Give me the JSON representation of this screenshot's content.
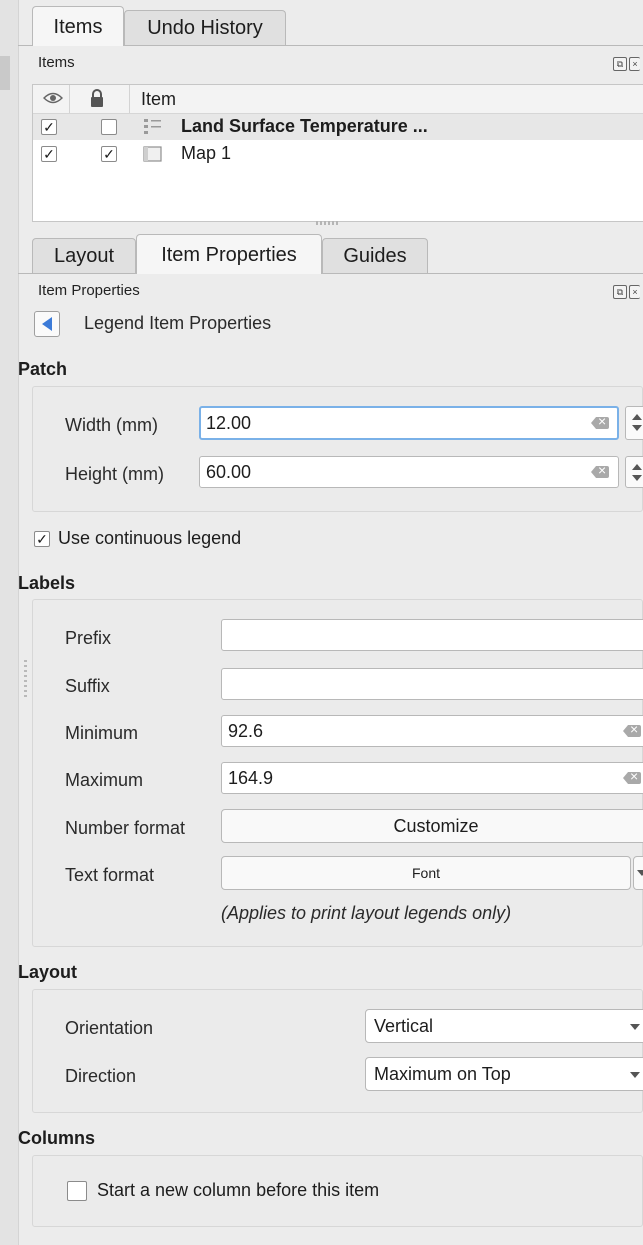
{
  "top_tabs": [
    "Items",
    "Undo History"
  ],
  "items_dock": {
    "title": "Items",
    "column_item": "Item",
    "rows": [
      {
        "name": "Land Surface Temperature ...",
        "visible": "✓",
        "locked": "",
        "bold": true
      },
      {
        "name": "Map 1",
        "visible": "✓",
        "locked": "✓",
        "bold": false
      }
    ]
  },
  "lower_tabs": [
    "Layout",
    "Item Properties",
    "Guides"
  ],
  "props_dock": {
    "title": "Item Properties",
    "header": "Legend Item Properties"
  },
  "patch": {
    "title": "Patch",
    "width_label": "Width (mm)",
    "width_value": "12.00",
    "height_label": "Height (mm)",
    "height_value": "60.00"
  },
  "continuous": {
    "checkmark": "✓",
    "label": "Use continuous legend"
  },
  "labels": {
    "title": "Labels",
    "prefix_label": "Prefix",
    "prefix_value": "",
    "suffix_label": "Suffix",
    "suffix_value": "",
    "minimum_label": "Minimum",
    "minimum_value": "92.6",
    "maximum_label": "Maximum",
    "maximum_value": "164.9",
    "number_format_label": "Number format",
    "customize_button": "Customize",
    "text_format_label": "Text format",
    "font_button": "Font",
    "note": "(Applies to print layout legends only)"
  },
  "layout_section": {
    "title": "Layout",
    "orientation_label": "Orientation",
    "orientation_value": "Vertical",
    "direction_label": "Direction",
    "direction_value": "Maximum on Top"
  },
  "columns": {
    "title": "Columns",
    "new_column_label": "Start a new column before this item"
  }
}
